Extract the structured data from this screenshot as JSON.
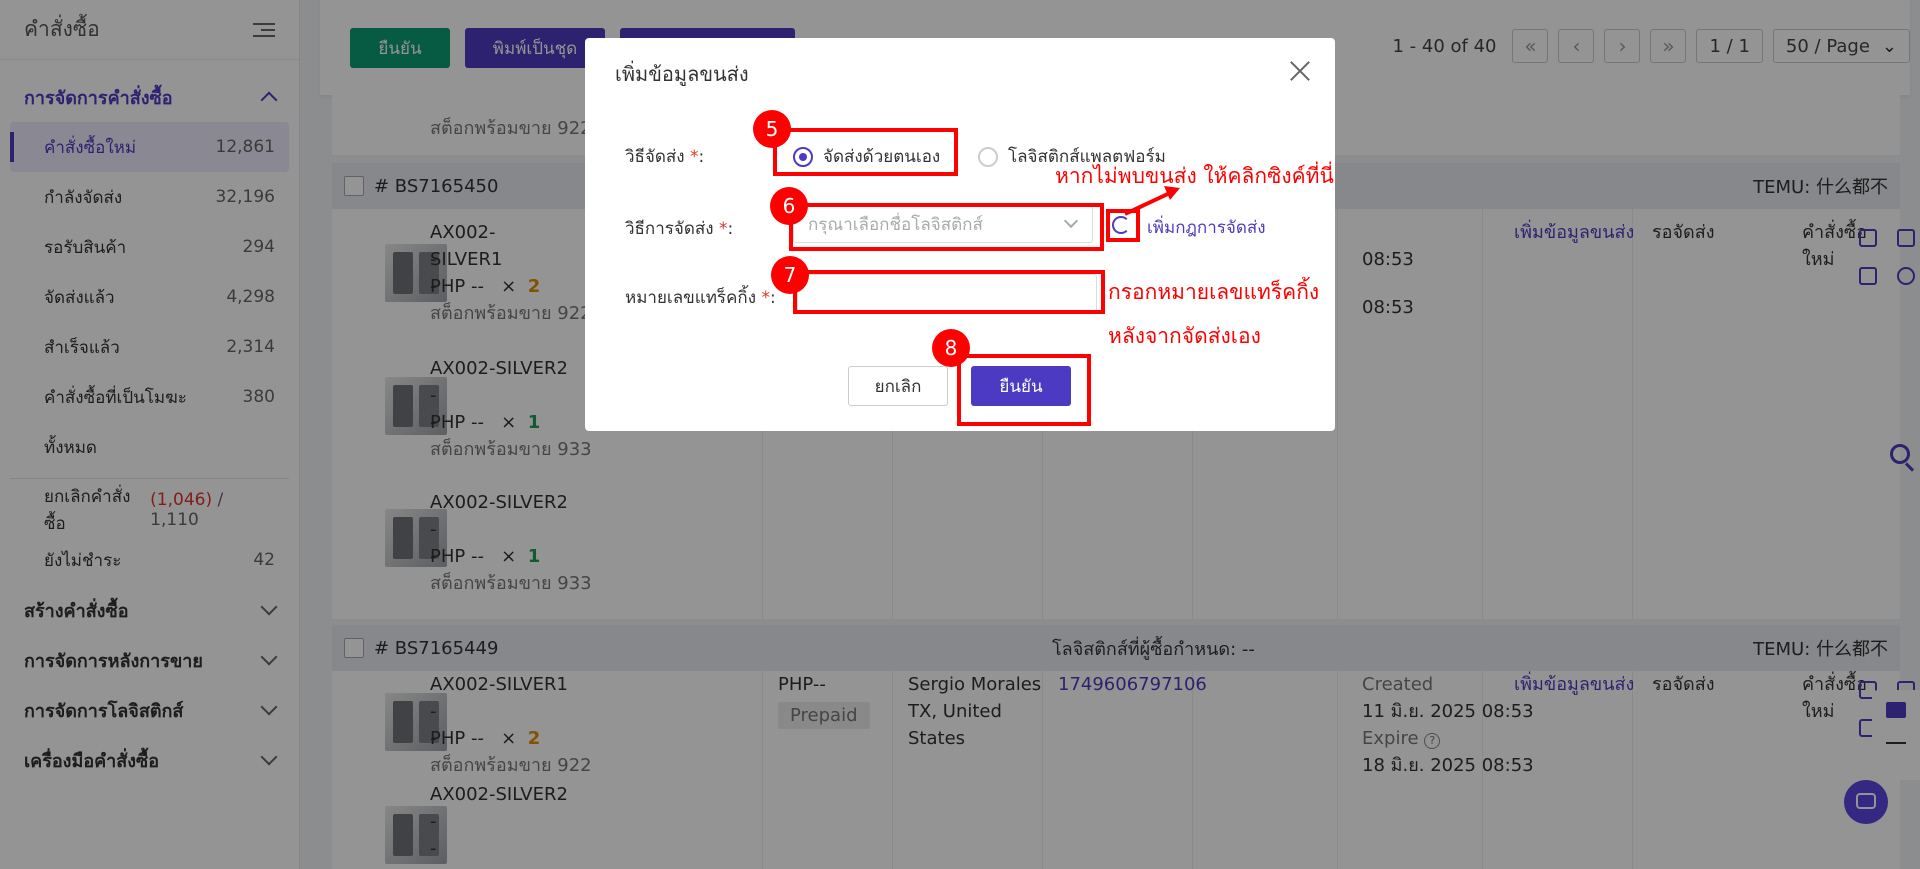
{
  "sidebar": {
    "title": "คำสั่งซื้อ",
    "section_manage": "การจัดการคำสั่งซื้อ",
    "items": [
      {
        "label": "คำสั่งซื้อใหม่",
        "count": "12,861"
      },
      {
        "label": "กำลังจัดส่ง",
        "count": "32,196"
      },
      {
        "label": "รอรับสินค้า",
        "count": "294"
      },
      {
        "label": "จัดส่งแล้ว",
        "count": "4,298"
      },
      {
        "label": "สำเร็จแล้ว",
        "count": "2,314"
      },
      {
        "label": "คำสั่งซื้อที่เป็นโมฆะ",
        "count": "380"
      },
      {
        "label": "ทั้งหมด",
        "count": ""
      }
    ],
    "cancel_item": {
      "label": "ยกเลิกคำสั่งซื้อ",
      "count_red": "(1,046)",
      "sep": "/",
      "count": "1,110"
    },
    "unpaid_item": {
      "label": "ยังไม่ชำระ",
      "count": "42"
    },
    "sections": [
      "สร้างคำสั่งซื้อ",
      "การจัดการหลังการขาย",
      "การจัดการโลจิสติกส์",
      "เครื่องมือคำสั่งซื้อ"
    ]
  },
  "toolbar": {
    "confirm_label": "ยืนยัน",
    "print_label": "พิมพ์เป็นชุด",
    "range_text": "1 - 40 of 40",
    "page_text": "1 / 1",
    "page_size": "50 / Page"
  },
  "orders": [
    {
      "id": "# BS7165450",
      "mid": "",
      "platform": "TEMU: 什么都不"
    },
    {
      "id": "# BS7165449",
      "mid": "โลจิสติกส์ที่ผู้ซื้อกำหนด: --",
      "platform": "TEMU: 什么都不"
    }
  ],
  "rows": {
    "stock_922": "สต็อกพร้อมขาย 922",
    "stock_933": "สต็อกพร้อมขาย 933",
    "sku1": "AX002-SILVER1",
    "sku2": "AX002-SILVER2",
    "dash": "--",
    "php": "PHP --",
    "times": "×",
    "qty2": "2",
    "qty1": "1",
    "price_php": "PHP--",
    "prepaid": "Prepaid",
    "buyer_name": "Sergio Morales",
    "buyer_loc": "TX, United",
    "buyer_country": "States",
    "phone": "1749606797106",
    "created_label": "Created",
    "created_date": "11 มิ.ย. 2025 08:53",
    "expire_label": "Expire",
    "expire_date": "18 มิ.ย. 2025 08:53",
    "add_shipping": "เพิ่มข้อมูลขนส่ง",
    "wait_ship": "รอจัดส่ง",
    "new_order_1": "คำสั่งซื้อ",
    "new_order_2": "ใหม่",
    "time_0853": "08:53"
  },
  "modal": {
    "title": "เพิ่มข้อมูลขนส่ง",
    "ship_label": "วิธีจัดส่ง",
    "radio_self": "จัดส่งด้วยตนเอง",
    "radio_platform": "โลจิสติกส์แพลตฟอร์ม",
    "method_label": "วิธีการจัดส่ง",
    "method_placeholder": "กรุณาเลือกชื่อโลจิสติกส์",
    "add_rule": "เพิ่มกฎการจัดส่ง",
    "tracking_label": "หมายเลขแทร็คกิ้ง",
    "cancel": "ยกเลิก",
    "confirm": "ยืนยัน",
    "req_mark": "*",
    "colon": ":"
  },
  "annotations": {
    "n5": "5",
    "n6": "6",
    "n7": "7",
    "n8": "8",
    "note_sync": "หากไม่พบขนส่ง ให้คลิกซิงค์ที่นี่",
    "note_track_1": "กรอกหมายเลขแทร็คกิ้ง",
    "note_track_2": "หลังจากจัดส่งเอง"
  },
  "colors": {
    "accent": "#4c3bc2",
    "green": "#0f9d74",
    "annotation": "#ff0000"
  }
}
